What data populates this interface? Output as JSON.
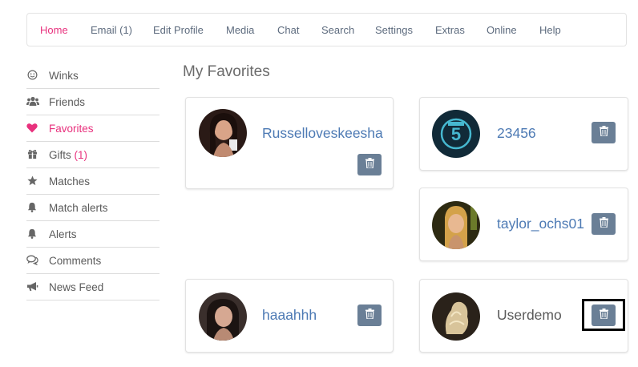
{
  "nav": {
    "items": [
      {
        "label": "Home",
        "active": true
      },
      {
        "label": "Email (1)"
      },
      {
        "label": "Edit Profile"
      },
      {
        "label": "Media"
      },
      {
        "label": "Chat"
      },
      {
        "label": "Search"
      },
      {
        "label": "Settings"
      },
      {
        "label": "Extras"
      },
      {
        "label": "Online"
      },
      {
        "label": "Help"
      }
    ]
  },
  "sidebar": {
    "items": [
      {
        "label": "Winks",
        "icon": "smile-icon"
      },
      {
        "label": "Friends",
        "icon": "users-icon"
      },
      {
        "label": "Favorites",
        "icon": "heart-icon",
        "active": true
      },
      {
        "label": "Gifts ",
        "count": "(1)",
        "icon": "gift-icon"
      },
      {
        "label": "Matches",
        "icon": "star-icon"
      },
      {
        "label": "Match alerts",
        "icon": "bell-icon"
      },
      {
        "label": "Alerts",
        "icon": "bell-icon"
      },
      {
        "label": "Comments",
        "icon": "comments-icon"
      },
      {
        "label": "News Feed",
        "icon": "bullhorn-icon"
      }
    ]
  },
  "main": {
    "title": "My Favorites",
    "favorites": [
      {
        "username": "Russelloveskeesha"
      },
      {
        "username": "23456"
      },
      {
        "username": "taylor_ochs01"
      },
      {
        "username": "haaahhh"
      },
      {
        "username": "Userdemo"
      }
    ]
  },
  "colors": {
    "accent": "#e8317d",
    "link": "#4d7ab4",
    "trash_button": "#6a7f96"
  }
}
